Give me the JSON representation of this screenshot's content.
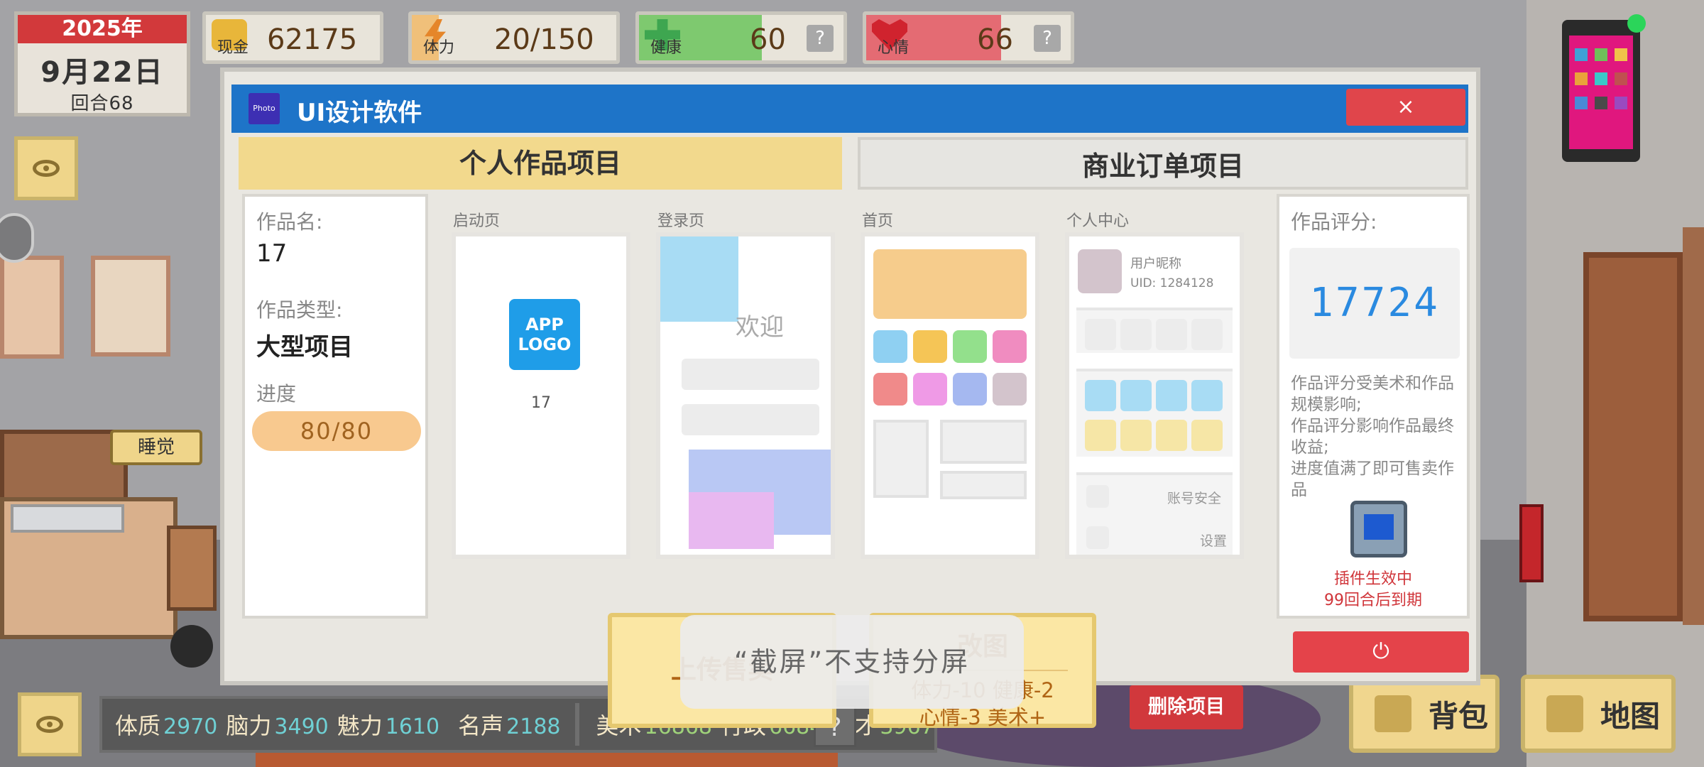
{
  "date": {
    "year": "2025年",
    "day": "9月22日",
    "round": "回合68"
  },
  "stats": {
    "cash": {
      "label": "现金",
      "value": "62175"
    },
    "stamina": {
      "label": "体力",
      "value": "20/150",
      "fraction": 0.133
    },
    "health": {
      "label": "健康",
      "value": "60",
      "fraction": 0.6,
      "help": "?"
    },
    "mood": {
      "label": "心情",
      "value": "66",
      "fraction": 0.66,
      "help": "?"
    }
  },
  "scene": {
    "sleep_label": "睡觉"
  },
  "dialog": {
    "app_icon_text": "Photo",
    "title": "UI设计软件",
    "close_label": "×",
    "tabs": [
      {
        "label": "个人作品项目",
        "active": true
      },
      {
        "label": "商业订单项目",
        "active": false
      }
    ],
    "left_panel": {
      "name_label": "作品名:",
      "name_value": "17",
      "type_label": "作品类型:",
      "type_value": "大型项目",
      "progress_label": "进度",
      "progress_value": "80/80"
    },
    "screens": {
      "splash": {
        "label": "启动页",
        "logo_line1": "APP",
        "logo_line2": "LOGO",
        "caption": "17"
      },
      "login": {
        "label": "登录页",
        "welcome": "欢迎"
      },
      "home": {
        "label": "首页"
      },
      "profile": {
        "label": "个人中心",
        "nickname": "用户昵称",
        "uid": "UID: 1284128",
        "row_security": "账号安全",
        "row_settings": "设置"
      }
    },
    "buttons": {
      "upload": "上传售卖",
      "edit_title": "改图",
      "edit_cost_line1": "体力-10 健康-2",
      "edit_cost_line2": "心情-3 美术+",
      "delete": "删除项目",
      "power": "⏻"
    },
    "right_panel": {
      "score_label": "作品评分:",
      "score_value": "17724",
      "desc": "作品评分受美术和作品规模影响;\n作品评分影响作品最终收益;\n进度值满了即可售卖作品",
      "plugin_line1": "插件生效中",
      "plugin_line2": "99回合后到期"
    }
  },
  "toast": "“截屏”不支持分屏",
  "attributes": [
    {
      "label": "体质",
      "value": "2970"
    },
    {
      "label": "脑力",
      "value": "3490"
    },
    {
      "label": "魅力",
      "value": "1610"
    },
    {
      "label": "名声",
      "value": "2188"
    }
  ],
  "skills": [
    {
      "label": "美术",
      "value": "16868"
    },
    {
      "label": "行政",
      "value": "6684"
    },
    {
      "label": "农才",
      "value": "3967"
    }
  ],
  "attr_help": "?",
  "bottom_buttons": {
    "bag": "背包",
    "map": "地图"
  },
  "colors": {
    "title_bar": "#1e74c8",
    "accent_yellow": "#f2d98d",
    "danger_red": "#e0454b",
    "score_blue": "#2a8ae0"
  }
}
